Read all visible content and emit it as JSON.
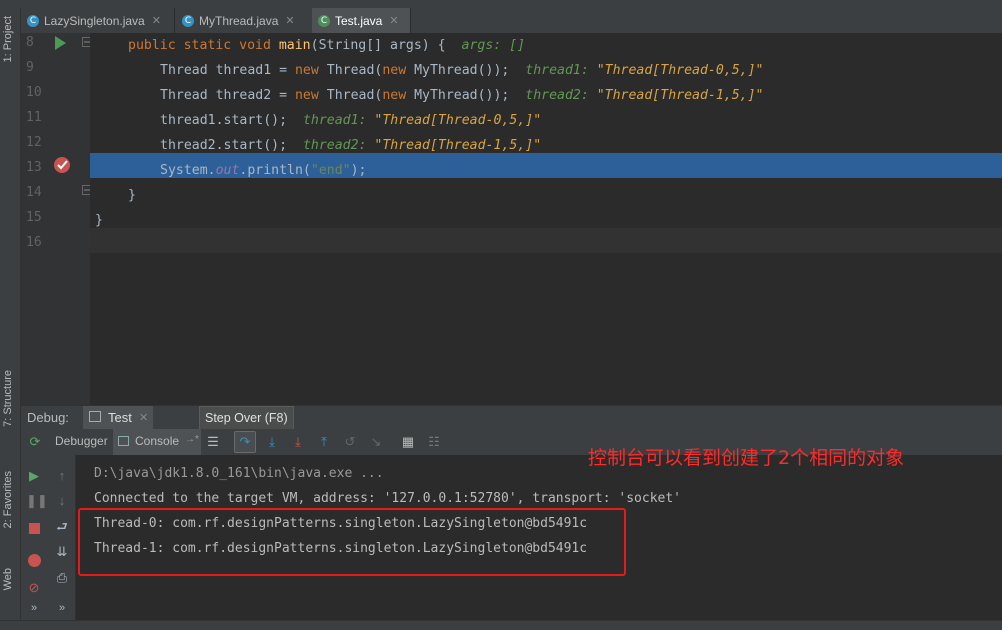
{
  "side_labels": {
    "project": "1: Project",
    "structure": "7: Structure",
    "favorites": "2: Favorites",
    "web": "Web"
  },
  "tabs": [
    {
      "label": "LazySingleton.java",
      "icon": "class-c-icon"
    },
    {
      "label": "MyThread.java",
      "icon": "class-c-icon"
    },
    {
      "label": "Test.java",
      "icon": "class-c-icon"
    }
  ],
  "line_numbers": [
    "8",
    "9",
    "10",
    "11",
    "12",
    "13",
    "14",
    "15",
    "16"
  ],
  "code": {
    "l8": {
      "kw": "public static void ",
      "fn": "main",
      "rest": "(String[] args) {",
      "hint": "args: []"
    },
    "l9": {
      "type": "Thread thread1 = ",
      "kw": "new ",
      "a": "Thread(",
      "kw2": "new ",
      "b": "MyThread());",
      "hintname": "thread1: ",
      "hintval": "\"Thread[Thread-0,5,]\""
    },
    "l10": {
      "type": "Thread thread2 = ",
      "kw": "new ",
      "a": "Thread(",
      "kw2": "new ",
      "b": "MyThread());",
      "hintname": "thread2: ",
      "hintval": "\"Thread[Thread-1,5,]\""
    },
    "l11": {
      "code": "thread1.start();",
      "hintname": "thread1: ",
      "hintval": "\"Thread[Thread-0,5,]\""
    },
    "l12": {
      "code": "thread2.start();",
      "hintname": "thread2: ",
      "hintval": "\"Thread[Thread-1,5,]\""
    },
    "l13": {
      "a": "System.",
      "fld": "out",
      "b": ".println(",
      "str": "\"end\"",
      "c": ");"
    },
    "l14": "}",
    "l15": "}"
  },
  "debug": {
    "label": "Debug:",
    "run_tab": "Test",
    "tab_debugger": "Debugger",
    "tab_console": "Console",
    "tooltip": "Step Over (F8)"
  },
  "console_lines": [
    "D:\\java\\jdk1.8.0_161\\bin\\java.exe ...",
    "Connected to the target VM, address: '127.0.0.1:52780', transport: 'socket'",
    "Thread-0: com.rf.designPatterns.singleton.LazySingleton@bd5491c",
    "Thread-1: com.rf.designPatterns.singleton.LazySingleton@bd5491c"
  ],
  "annotation": "控制台可以看到创建了2个相同的对象",
  "colors": {
    "accent_blue": "#2d6099",
    "annotation_red": "#ff2a2a",
    "keyword": "#cc7832"
  }
}
